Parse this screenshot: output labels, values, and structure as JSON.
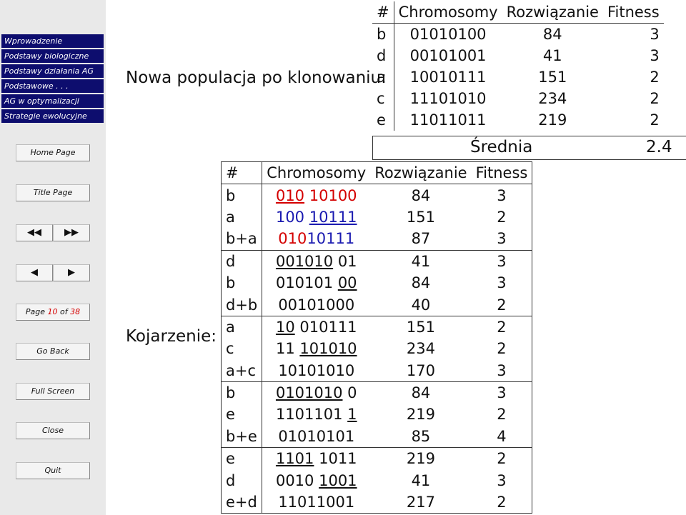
{
  "sidebar": {
    "sections": [
      {
        "label": "Wprowadzenie"
      },
      {
        "label": "Podstawy biologiczne"
      },
      {
        "label": "Podstawy działania AG"
      },
      {
        "label": "Podstawowe . . ."
      },
      {
        "label": "AG w optymalizacji"
      },
      {
        "label": "Strategie ewolucyjne"
      }
    ],
    "home": "Home Page",
    "title": "Title Page",
    "first_icon": "◀◀",
    "last_icon": "▶▶",
    "prev_icon": "◀",
    "next_icon": "▶",
    "page_prefix": "Page ",
    "page_current": "10",
    "page_of": " of ",
    "page_total": "38",
    "go_back": "Go Back",
    "full_screen": "Full Screen",
    "close": "Close",
    "quit": "Quit"
  },
  "labels": {
    "new_population": "Nowa populacja po klonowaniu:",
    "crossover": "Kojarzenie:"
  },
  "top_table": {
    "headers": [
      "#",
      "Chromosomy",
      "Rozwiązanie",
      "Fitness"
    ],
    "rows": [
      [
        "b",
        "01010100",
        "84",
        "3"
      ],
      [
        "d",
        "00101001",
        "41",
        "3"
      ],
      [
        "a",
        "10010111",
        "151",
        "2"
      ],
      [
        "c",
        "11101010",
        "234",
        "2"
      ],
      [
        "e",
        "11011011",
        "219",
        "2"
      ]
    ],
    "average_label": "Średnia",
    "average_value": "2.4"
  },
  "main_table": {
    "headers": [
      "#",
      "Chromosomy",
      "Rozwiązanie",
      "Fitness"
    ],
    "rows": [
      {
        "id": "b",
        "chrom_a": "010",
        "chrom_b": "10100",
        "sol": "84",
        "fit": "3"
      },
      {
        "id": "a",
        "chrom_a": "100",
        "chrom_b": "10111",
        "sol": "151",
        "fit": "2"
      },
      {
        "id": "b+a",
        "chrom_a": "010",
        "chrom_b": "10111",
        "sol": "87",
        "fit": "3"
      },
      {
        "id": "d",
        "chrom_a": "001010",
        "chrom_b": "01",
        "sol": "41",
        "fit": "3"
      },
      {
        "id": "b",
        "chrom_a": "010101",
        "chrom_b": "00",
        "sol": "84",
        "fit": "3"
      },
      {
        "id": "d+b",
        "chrom_a": "00101000",
        "chrom_b": "",
        "sol": "40",
        "fit": "2"
      },
      {
        "id": "a",
        "chrom_a": "10",
        "chrom_b": "010111",
        "sol": "151",
        "fit": "2"
      },
      {
        "id": "c",
        "chrom_a": "11",
        "chrom_b": "101010",
        "sol": "234",
        "fit": "2"
      },
      {
        "id": "a+c",
        "chrom_a": "10101010",
        "chrom_b": "",
        "sol": "170",
        "fit": "3"
      },
      {
        "id": "b",
        "chrom_a": "0101010",
        "chrom_b": "0",
        "sol": "84",
        "fit": "3"
      },
      {
        "id": "e",
        "chrom_a": "1101101",
        "chrom_b": "1",
        "sol": "219",
        "fit": "2"
      },
      {
        "id": "b+e",
        "chrom_a": "01010101",
        "chrom_b": "",
        "sol": "85",
        "fit": "4"
      },
      {
        "id": "e",
        "chrom_a": "1101",
        "chrom_b": "1011",
        "sol": "219",
        "fit": "2"
      },
      {
        "id": "d",
        "chrom_a": "0010",
        "chrom_b": "1001",
        "sol": "41",
        "fit": "3"
      },
      {
        "id": "e+d",
        "chrom_a": "11011001",
        "chrom_b": "",
        "sol": "217",
        "fit": "2"
      }
    ]
  },
  "colors": {
    "nav_bg": "#0d0d6e",
    "red": "#d40000",
    "blue": "#1a1ab0"
  }
}
